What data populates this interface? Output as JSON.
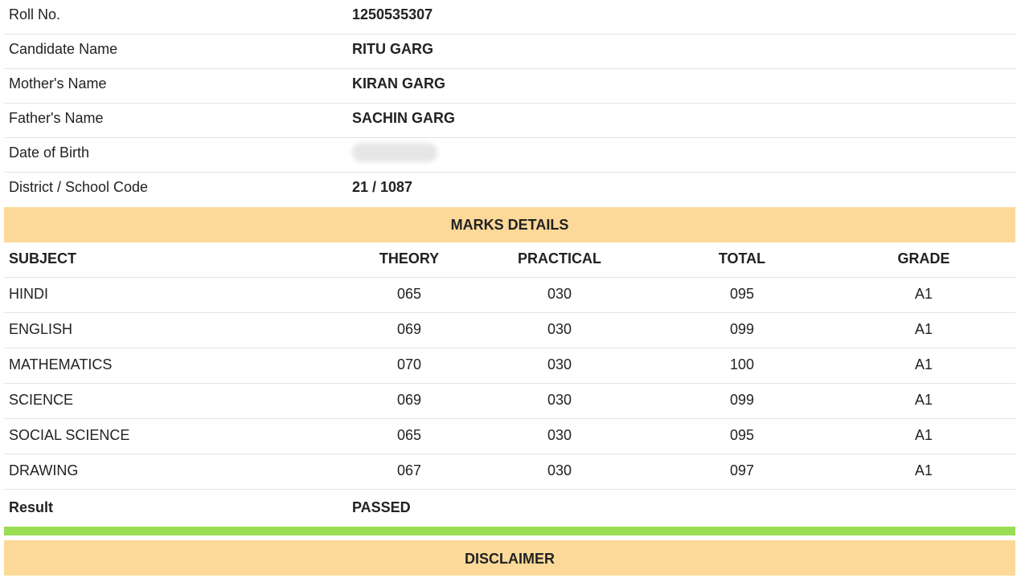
{
  "student": {
    "rows": [
      {
        "label": "Roll No.",
        "value": "1250535307"
      },
      {
        "label": "Candidate Name",
        "value": "RITU GARG"
      },
      {
        "label": "Mother's Name",
        "value": "KIRAN GARG"
      },
      {
        "label": "Father's Name",
        "value": "SACHIN GARG"
      },
      {
        "label": "Date of Birth",
        "value": ""
      },
      {
        "label": "District / School Code",
        "value": "21 / 1087"
      }
    ]
  },
  "marks": {
    "title": "MARKS DETAILS",
    "headers": {
      "subject": "SUBJECT",
      "theory": "THEORY",
      "practical": "PRACTICAL",
      "total": "TOTAL",
      "grade": "GRADE"
    },
    "rows": [
      {
        "subject": "HINDI",
        "theory": "065",
        "practical": "030",
        "total": "095",
        "grade": "A1"
      },
      {
        "subject": "ENGLISH",
        "theory": "069",
        "practical": "030",
        "total": "099",
        "grade": "A1"
      },
      {
        "subject": "MATHEMATICS",
        "theory": "070",
        "practical": "030",
        "total": "100",
        "grade": "A1"
      },
      {
        "subject": "SCIENCE",
        "theory": "069",
        "practical": "030",
        "total": "099",
        "grade": "A1"
      },
      {
        "subject": "SOCIAL SCIENCE",
        "theory": "065",
        "practical": "030",
        "total": "095",
        "grade": "A1"
      },
      {
        "subject": "DRAWING",
        "theory": "067",
        "practical": "030",
        "total": "097",
        "grade": "A1"
      }
    ]
  },
  "result": {
    "label": "Result",
    "value": "PASSED"
  },
  "disclaimer": {
    "title": "DISCLAIMER"
  },
  "colors": {
    "band": "#fcd999",
    "green_bar": "#99dd55",
    "divider": "#e3e3e3"
  }
}
